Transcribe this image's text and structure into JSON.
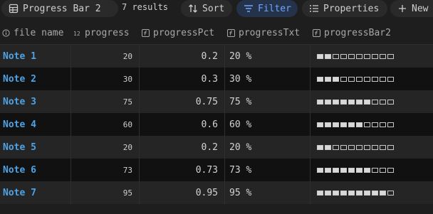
{
  "toolbar": {
    "view_label": "Progress Bar 2",
    "results": "7 results",
    "sort_label": "Sort",
    "filter_label": "Filter",
    "properties_label": "Properties",
    "new_label": "New"
  },
  "columns": [
    {
      "label": "file name",
      "icon": "info-circle-icon"
    },
    {
      "label": "progress",
      "icon": "number-icon"
    },
    {
      "label": "progressPct",
      "icon": "formula-icon"
    },
    {
      "label": "progressTxt",
      "icon": "formula-icon"
    },
    {
      "label": "progressBar2",
      "icon": "formula-icon"
    }
  ],
  "rows": [
    {
      "name": "Note 1",
      "progress": "20",
      "pct": "0.2",
      "txt": "20 %",
      "fill": 0.2
    },
    {
      "name": "Note 2",
      "progress": "30",
      "pct": "0.3",
      "txt": "30 %",
      "fill": 0.3
    },
    {
      "name": "Note 3",
      "progress": "75",
      "pct": "0.75",
      "txt": "75 %",
      "fill": 0.75
    },
    {
      "name": "Note 4",
      "progress": "60",
      "pct": "0.6",
      "txt": "60 %",
      "fill": 0.6
    },
    {
      "name": "Note 5",
      "progress": "20",
      "pct": "0.2",
      "txt": "20 %",
      "fill": 0.2
    },
    {
      "name": "Note 6",
      "progress": "73",
      "pct": "0.73",
      "txt": "73 %",
      "fill": 0.73
    },
    {
      "name": "Note 7",
      "progress": "95",
      "pct": "0.95",
      "txt": "95 %",
      "fill": 0.95
    }
  ],
  "colors": {
    "accent": "#6ea6ff",
    "link": "#4ea3e6",
    "row_odd": "#252526",
    "row_even": "#111111"
  }
}
